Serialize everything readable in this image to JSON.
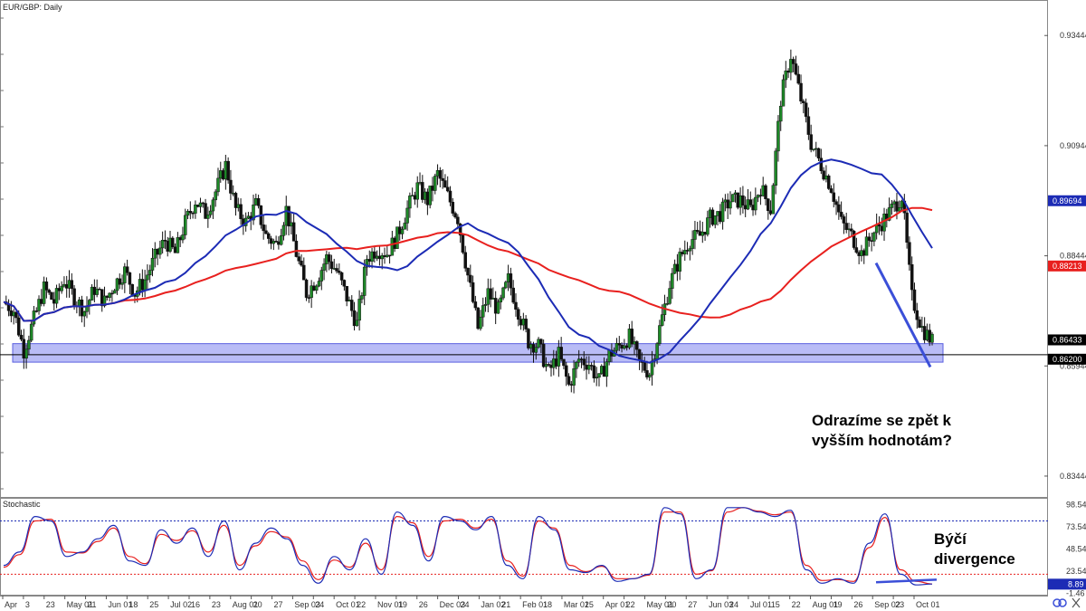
{
  "symbol_label": "EUR/GBP: Daily",
  "indicator_label": "Stochastic",
  "annotations": {
    "main_line1": "Odrazíme se zpět k",
    "main_line2": "vyšším hodnotám?",
    "stoch_line1": "Býčí",
    "stoch_line2": "divergence"
  },
  "colors": {
    "ma_fast": "#1c2bb5",
    "ma_slow": "#e8201e",
    "candle_up": "#1e8a28",
    "candle_down": "#111111",
    "support_zone": "#8a8ff0",
    "trendline": "#3b4fd8",
    "stoch_k": "#1c2bb5",
    "stoch_d": "#e8201e",
    "price_tag_current": "#000000",
    "stoch_tag": "#1c2bb5"
  },
  "chart_data": [
    {
      "type": "candlestick",
      "y_ticks": [
        "0.93444",
        "0.90944",
        "0.88444",
        "0.85944",
        "0.83444"
      ],
      "ylim": [
        0.8295,
        0.9425
      ],
      "price_tags": [
        {
          "value": "0.89694",
          "color": "ma_fast"
        },
        {
          "value": "0.88213",
          "color": "ma_slow"
        },
        {
          "value": "0.86433",
          "color": "price_tag_current"
        },
        {
          "value": "0.86200",
          "color": "price_tag_current"
        }
      ],
      "x_ticks": [
        "Apr",
        "3",
        "23",
        "May 01",
        "21",
        "Jun 01",
        "18",
        "25",
        "Jul 02",
        "16",
        "23",
        "Aug 01",
        "20",
        "27",
        "Sep 03",
        "24",
        "Oct 01",
        "22",
        "Nov 01",
        "19",
        "26",
        "Dec 03",
        "24",
        "Jan 02",
        "21",
        "Feb 01",
        "18",
        "Mar 01",
        "25",
        "Apr 01",
        "22",
        "May 01",
        "20",
        "27",
        "Jun 03",
        "24",
        "Jul 01",
        "15",
        "22",
        "Aug 01",
        "19",
        "26",
        "Sep 02",
        "23",
        "Oct 01"
      ],
      "support_zone": [
        0.8603,
        0.8645
      ],
      "close_series": [
        0.874,
        0.872,
        0.863,
        0.87,
        0.877,
        0.874,
        0.879,
        0.875,
        0.872,
        0.877,
        0.874,
        0.878,
        0.881,
        0.876,
        0.879,
        0.884,
        0.888,
        0.885,
        0.892,
        0.897,
        0.894,
        0.899,
        0.905,
        0.895,
        0.892,
        0.896,
        0.889,
        0.887,
        0.895,
        0.885,
        0.876,
        0.879,
        0.884,
        0.881,
        0.875,
        0.869,
        0.884,
        0.886,
        0.885,
        0.889,
        0.895,
        0.9,
        0.897,
        0.903,
        0.898,
        0.893,
        0.88,
        0.868,
        0.876,
        0.872,
        0.879,
        0.872,
        0.865,
        0.864,
        0.858,
        0.862,
        0.855,
        0.861,
        0.86,
        0.856,
        0.862,
        0.864,
        0.866,
        0.86,
        0.858,
        0.868,
        0.878,
        0.884,
        0.888,
        0.889,
        0.893,
        0.894,
        0.897,
        0.897,
        0.895,
        0.9,
        0.895,
        0.92,
        0.93,
        0.92,
        0.91,
        0.905,
        0.9,
        0.892,
        0.889,
        0.885,
        0.889,
        0.892,
        0.895,
        0.898,
        0.875,
        0.868,
        0.865
      ]
    },
    {
      "type": "line",
      "title": "Stochastic",
      "y_ticks": [
        "98.54",
        "73.54",
        "48.54",
        "23.54",
        "-1.46"
      ],
      "ylim": [
        -4,
        106
      ],
      "levels": [
        80,
        20
      ],
      "value_tag": "8.89",
      "k_series": [
        30,
        45,
        85,
        80,
        40,
        45,
        60,
        75,
        35,
        30,
        70,
        55,
        72,
        40,
        80,
        25,
        55,
        72,
        60,
        30,
        10,
        40,
        25,
        60,
        20,
        90,
        75,
        35,
        85,
        80,
        70,
        85,
        30,
        15,
        85,
        70,
        25,
        22,
        30,
        12,
        15,
        20,
        95,
        88,
        15,
        25,
        95,
        95,
        90,
        85,
        92,
        25,
        10,
        15,
        10,
        55,
        88,
        20,
        8,
        9
      ],
      "d_series": [
        28,
        42,
        80,
        82,
        45,
        44,
        57,
        72,
        40,
        32,
        65,
        58,
        69,
        45,
        75,
        30,
        52,
        68,
        62,
        35,
        14,
        36,
        28,
        55,
        25,
        85,
        78,
        40,
        80,
        82,
        72,
        82,
        35,
        18,
        80,
        72,
        30,
        23,
        29,
        15,
        15,
        19,
        90,
        90,
        20,
        24,
        90,
        95,
        91,
        87,
        90,
        30,
        13,
        14,
        12,
        50,
        84,
        25,
        12,
        9
      ]
    }
  ]
}
